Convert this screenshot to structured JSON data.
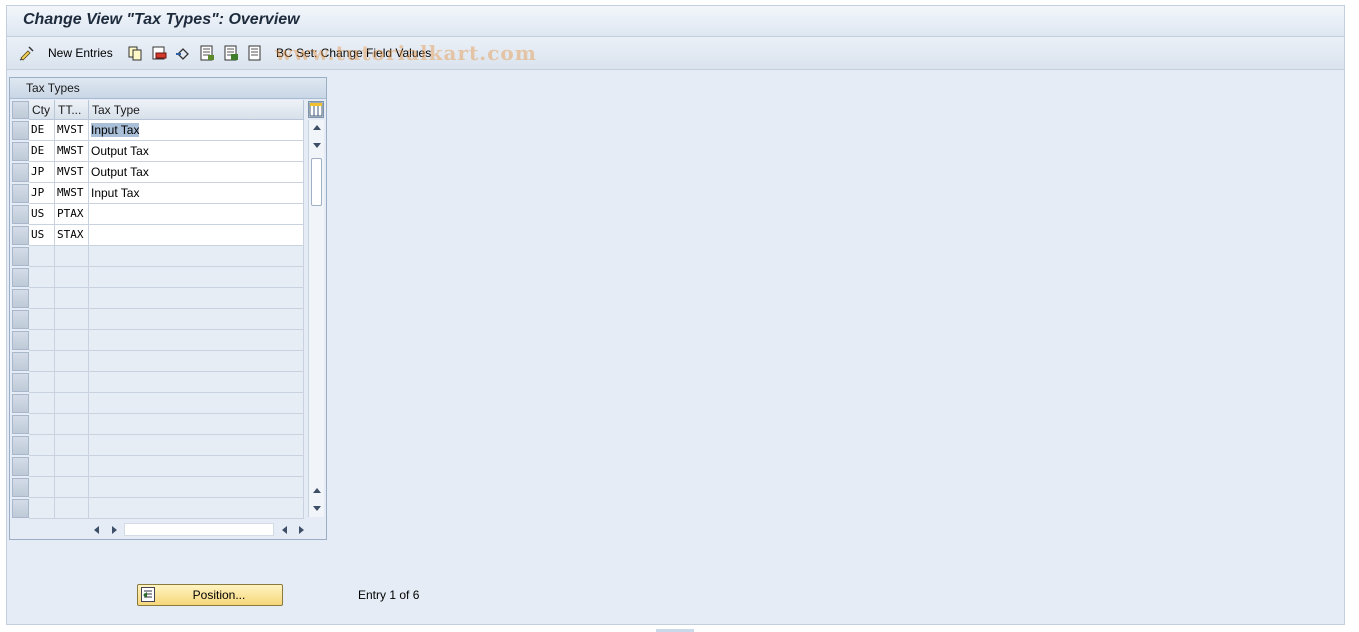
{
  "window": {
    "title": "Change View \"Tax Types\": Overview"
  },
  "toolbar": {
    "new_entries_label": "New Entries",
    "bc_set_label": "BC Set: Change Field Values",
    "icons": [
      "change-display-icon",
      "copy-icon",
      "delete-icon",
      "undo-icon",
      "select-all-icon",
      "select-block-icon",
      "deselect-all-icon"
    ]
  },
  "watermark": "www.tutorialkart.com",
  "table": {
    "title": "Tax Types",
    "columns": [
      "Cty",
      "TT...",
      "Tax Type"
    ],
    "rows": [
      {
        "cty": "DE",
        "tt": "MVST",
        "type": "Input Tax"
      },
      {
        "cty": "DE",
        "tt": "MWST",
        "type": "Output Tax"
      },
      {
        "cty": "JP",
        "tt": "MVST",
        "type": "Output Tax"
      },
      {
        "cty": "JP",
        "tt": "MWST",
        "type": "Input Tax"
      },
      {
        "cty": "US",
        "tt": "PTAX",
        "type": ""
      },
      {
        "cty": "US",
        "tt": "STAX",
        "type": ""
      }
    ],
    "empty_rows": 13
  },
  "footer": {
    "position_label": "Position...",
    "entry_info": "Entry 1 of 6"
  },
  "colors": {
    "background": "#e5ecf5",
    "button": "#f6d77a",
    "selection": "#a9bfd8"
  }
}
